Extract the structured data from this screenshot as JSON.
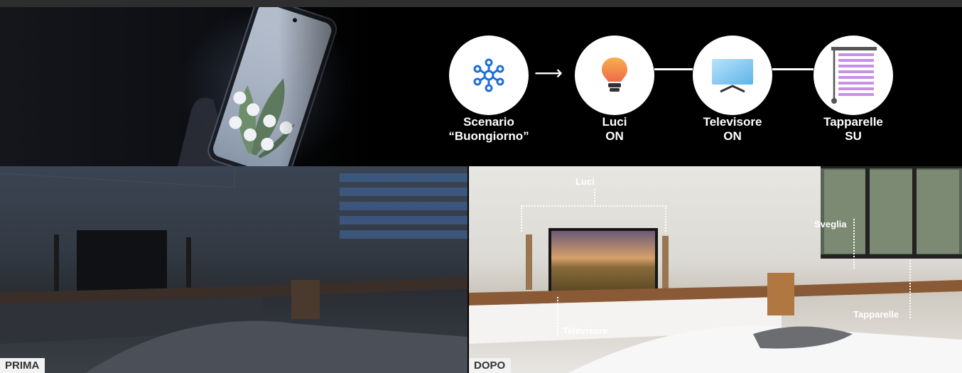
{
  "flow": {
    "trigger": {
      "line1": "Scenario",
      "line2": "“Buongiorno”"
    },
    "steps": [
      {
        "line1": "Luci",
        "line2": "ON"
      },
      {
        "line1": "Televisore",
        "line2": "ON"
      },
      {
        "line1": "Tapparelle",
        "line2": "SU"
      }
    ],
    "icons": [
      "smartthings-hub-icon",
      "light-bulb-icon",
      "tv-icon",
      "blinds-icon"
    ]
  },
  "before": {
    "caption": "PRIMA"
  },
  "after": {
    "caption": "DOPO",
    "callouts": {
      "lights": "Luci",
      "alarm": "Sveglia",
      "tv": "Televisore",
      "blinds": "Tapparelle"
    }
  },
  "colors": {
    "accent_blue": "#1e6fd9",
    "bulb_orange": "#f28a4a",
    "tv_blue": "#7ec5ee",
    "blind_purple": "#c890e6"
  }
}
